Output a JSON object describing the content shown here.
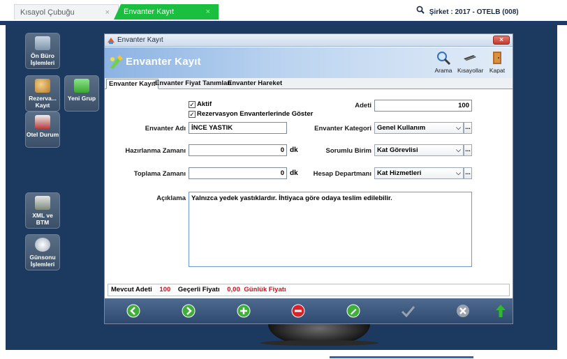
{
  "top_tabs": [
    {
      "label": "Kısayol Çubuğu",
      "close": "×"
    },
    {
      "label": "Envanter Kayıt",
      "close": "×"
    }
  ],
  "company": "Şirket : 2017 - OTELB (008)",
  "desktop_icons": [
    {
      "label": "Ön Büro İşlemleri",
      "icon": "front-office-icon"
    },
    {
      "label": "Rezerva... Kayıt",
      "icon": "reservation-icon"
    },
    {
      "label": "Yeni Grup",
      "icon": "folder-icon"
    },
    {
      "label": "Otel Durum",
      "icon": "hotel-status-icon"
    },
    {
      "label": "XML ve BTM",
      "icon": "xml-icon"
    },
    {
      "label": "Günsonu İşlemleri",
      "icon": "day-end-icon"
    }
  ],
  "window": {
    "title": "Envanter Kayıt",
    "close": "×",
    "header_title": "Envanter Kayıt",
    "header_buttons": [
      {
        "label": "Arama",
        "icon": "search-icon"
      },
      {
        "label": "Kısayollar",
        "icon": "shortcut-icon"
      },
      {
        "label": "Kapat",
        "icon": "door-exit-icon"
      }
    ],
    "tabs": [
      {
        "label": "Envanter Kayıt",
        "active": true
      },
      {
        "label": "Envanter Fiyat Tanımları",
        "active": false
      },
      {
        "label": "Envanter Hareket",
        "active": false
      }
    ]
  },
  "form": {
    "aktif_label": "Aktif",
    "aktif_checked": true,
    "rezervasyon_label": "Rezervasyon Envanterlerinde Göster",
    "rezervasyon_checked": true,
    "check_mark": "✓",
    "adeti_label": "Adeti",
    "adeti_value": "100",
    "envanter_adi_label": "Envanter Adı",
    "envanter_adi_value": "İNCE YASTIK",
    "envanter_kategori_label": "Envanter Kategori",
    "envanter_kategori_value": "Genel Kullanım",
    "hazirlanma_label": "Hazırlanma Zamanı",
    "hazirlanma_value": "0",
    "hazirlanma_unit": "dk",
    "sorumlu_label": "Sorumlu Birim",
    "sorumlu_value": "Kat Görevlisi",
    "toplama_label": "Toplama Zamanı",
    "toplama_value": "0",
    "toplama_unit": "dk",
    "hesap_label": "Hesap Departmanı",
    "hesap_value": "Kat Hizmetleri",
    "aciklama_label": "Açıklama",
    "aciklama_value": "Yalnızca yedek yastıklardır. İhtiyaca göre odaya teslim edilebilir.",
    "ellipsis": "...",
    "chevron": "⌵"
  },
  "status": {
    "mevcut_label": "Mevcut Adeti",
    "mevcut_value": "100",
    "gecerli_label": "Geçerli Fiyatı",
    "gecerli_value": "0,00",
    "gunluk_label": "Günlük Fiyatı"
  },
  "action_buttons": [
    {
      "icon": "back-icon",
      "color": "#3fae3a"
    },
    {
      "icon": "forward-icon",
      "color": "#3fae3a"
    },
    {
      "icon": "add-icon",
      "color": "#3fae3a"
    },
    {
      "icon": "delete-icon",
      "color": "#d8232a"
    },
    {
      "icon": "edit-icon",
      "color": "#3fae3a"
    },
    {
      "icon": "confirm-icon",
      "color": "#9aa3ad"
    },
    {
      "icon": "cancel-icon",
      "color": "#9aa3ad"
    },
    {
      "icon": "up-arrow-icon",
      "color": "#2fb82f"
    }
  ]
}
